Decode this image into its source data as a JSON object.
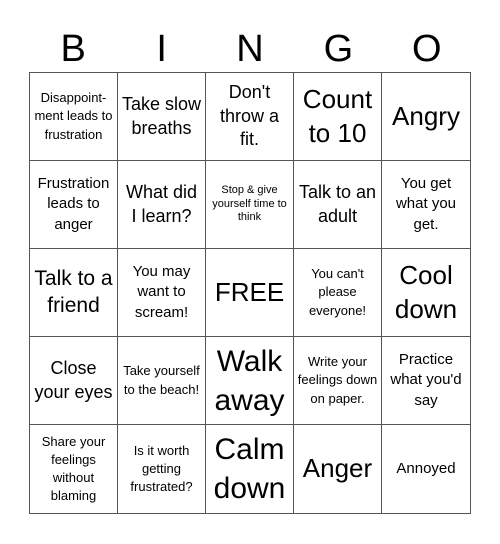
{
  "header": {
    "letters": [
      "B",
      "I",
      "N",
      "G",
      "O"
    ]
  },
  "board": {
    "rows": [
      [
        "Disappoint-ment leads to frustration",
        "Take slow breaths",
        "Don't throw a fit.",
        "Count to 10",
        "Angry"
      ],
      [
        "Frustration leads to anger",
        "What did I learn?",
        "Stop & give yourself time to think",
        "Talk to an adult",
        "You get what you get."
      ],
      [
        "Talk to a friend",
        "You may want to scream!",
        "FREE",
        "You can't please everyone!",
        "Cool down"
      ],
      [
        "Close your eyes",
        "Take yourself to the beach!",
        "Walk away",
        "Write your feelings down on paper.",
        "Practice what you'd say"
      ],
      [
        "Share your feelings without blaming",
        "Is it worth getting frustrated?",
        "Calm down",
        "Anger",
        "Annoyed"
      ]
    ]
  }
}
